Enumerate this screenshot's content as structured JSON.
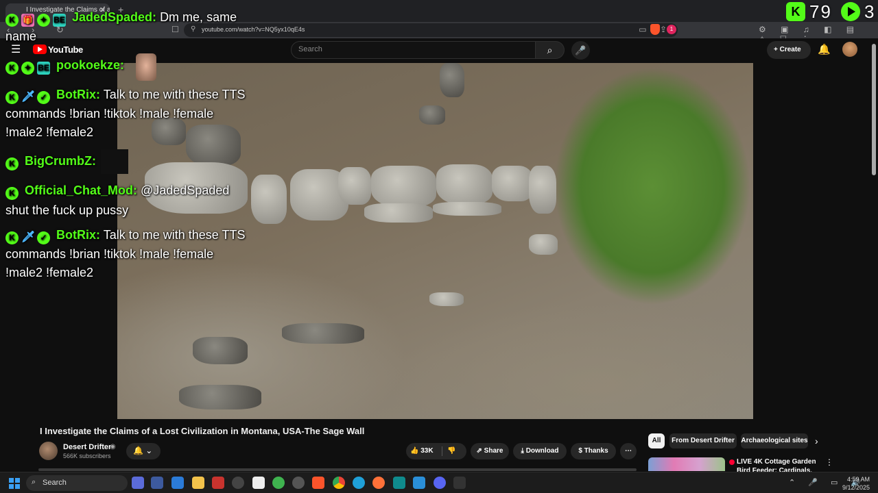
{
  "browser": {
    "tab_title": "I Investigate the Claims of a L",
    "tab_close": "✕",
    "new_tab": "+",
    "nav_icons": "‹ › ↻",
    "bookmark": "☐",
    "url": "youtube.com/watch?v=NQ5yx10qE4s",
    "url_icon": "⚲",
    "url_right_icons": "▭ ⇪",
    "ext_badge": "1",
    "extension_icons": "⚙ ▣ ♫ ◧ ▤ ✧ ⛉ ⋮"
  },
  "youtube": {
    "menu_icon": "☰",
    "logo_text": "YouTube",
    "search_placeholder": "Search",
    "search_icon": "⌕",
    "mic_icon": "🎤",
    "create_label": "+ Create",
    "bell_icon": "🔔"
  },
  "stream_overlay": {
    "viewer_count": "79",
    "play_count": "3",
    "kick_badge": "K"
  },
  "chat": [
    {
      "badges": [
        "K",
        "🎁",
        "✦",
        "BE"
      ],
      "user": "JadedSpaded:",
      "message": "Dm me, same"
    },
    {
      "continuation": "name"
    },
    {
      "badges": [
        "K",
        "✦",
        "BE"
      ],
      "user": "pookoekze:",
      "message": ""
    },
    {
      "badges": [
        "K",
        "🗡",
        "✓"
      ],
      "user": "BotRix:",
      "message": "Talk to me with these TTS"
    },
    {
      "continuation": "commands !brian !tiktok !male !female"
    },
    {
      "continuation": "!male2 !female2"
    },
    {
      "badges": [
        "K"
      ],
      "user": "BigCrumbZ:",
      "message": ""
    },
    {
      "badges": [
        "K"
      ],
      "user": "Official_Chat_Mod:",
      "message": "@JadedSpaded"
    },
    {
      "continuation": "shut the fuck up pussy"
    },
    {
      "badges": [
        "K",
        "🗡",
        "✓"
      ],
      "user": "BotRix:",
      "message": "Talk to me with these TTS"
    },
    {
      "continuation": "commands !brian !tiktok !male !female"
    },
    {
      "continuation": "!male2 !female2"
    }
  ],
  "video": {
    "title": "I Investigate the Claims of a Lost Civilization in Montana, USA-The Sage Wall",
    "channel": "Desert Drifter",
    "verified_icon": "◉",
    "subscribers": "566K subscribers",
    "notify_icon": "🔔 ⌄",
    "likes": "👍 33K",
    "dislike_icon": "👎",
    "share": "⇗ Share",
    "download": "⤓ Download",
    "thanks": "$ Thanks",
    "more": "⋯"
  },
  "chips": [
    "All",
    "From Desert Drifter",
    "Archaeological sites"
  ],
  "chip_next": "›",
  "recommendation": {
    "title": "LIVE 4K Cottage Garden Bird Feeder: Cardinals,",
    "more": "⋮"
  },
  "taskbar": {
    "search_label": "Search",
    "search_icon": "⌕",
    "tray_icons": "⌃ 🎤 ▭ 🔊",
    "time": "4:59 AM",
    "date": "9/12/2025"
  }
}
